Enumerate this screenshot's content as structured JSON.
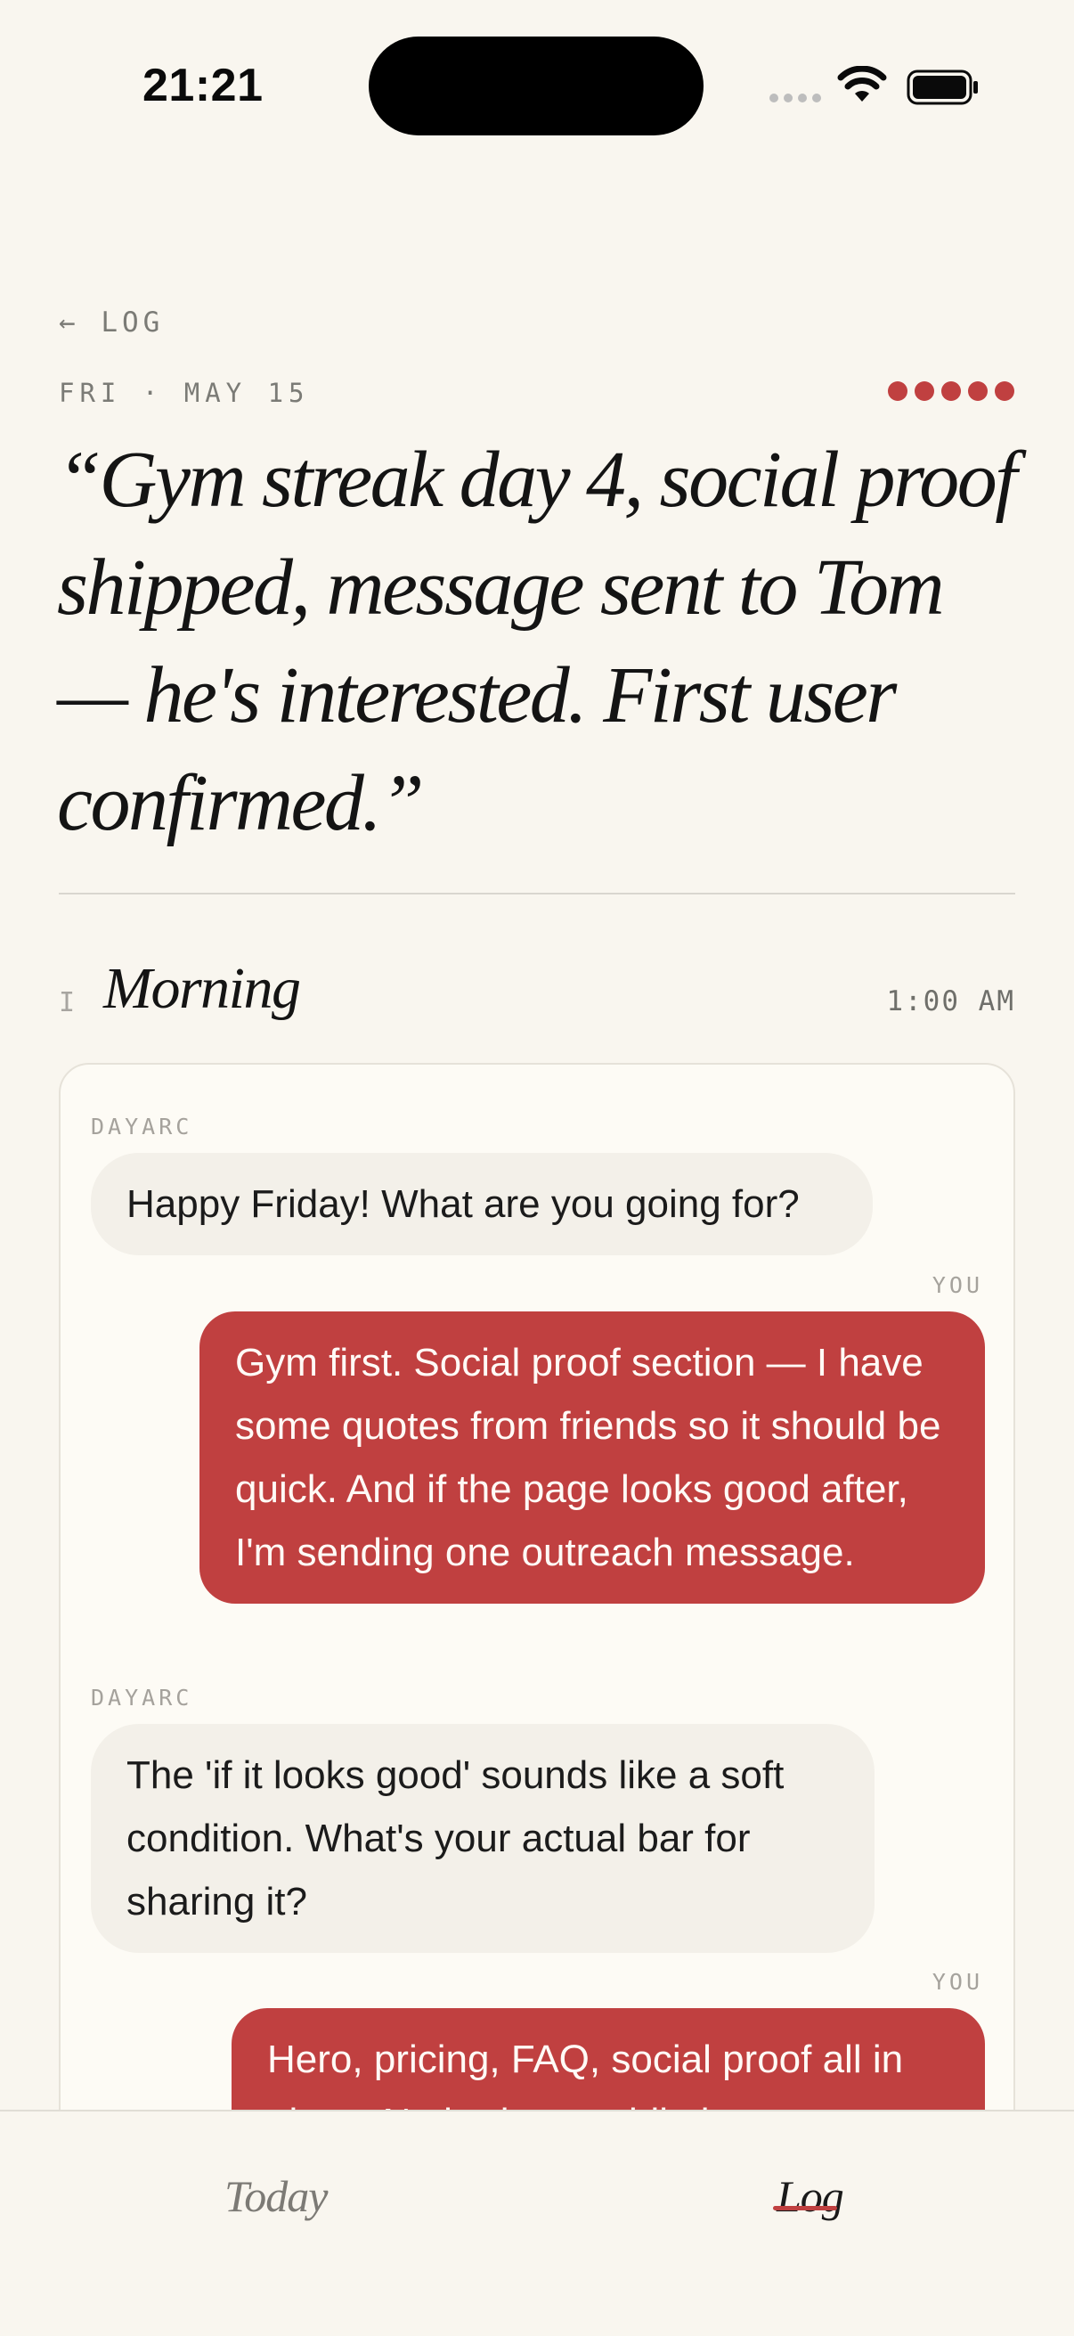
{
  "status_bar": {
    "time": "21:21"
  },
  "header": {
    "back_label": "← LOG",
    "date": "FRI · MAY 15",
    "rating": 5,
    "headline": "“Gym streak day 4, social proof shipped, message sent to Tom — he's interested. First user confirmed.”"
  },
  "section": {
    "number": "I",
    "title": "Morning",
    "time": "1:00 AM"
  },
  "chat": {
    "messages": [
      {
        "sender": "DAYARC",
        "text": "Happy Friday! What are you going for?"
      },
      {
        "sender": "YOU",
        "text": "Gym first. Social proof section — I have some quotes from friends so it should be quick. And if the page looks good after, I'm sending one outreach message."
      },
      {
        "sender": "DAYARC",
        "text": "The 'if it looks good' sounds like a soft condition. What's your actual bar for sharing it?"
      },
      {
        "sender": "YOU",
        "text": "Hero, pricing, FAQ, social proof all in place. No broken mobile layout."
      }
    ]
  },
  "bottom_nav": {
    "items": [
      {
        "label": "Today"
      },
      {
        "label": "Log"
      }
    ],
    "active": "Log"
  },
  "colors": {
    "accent": "#c04040",
    "background": "#f9f6ef",
    "card": "#fdfbf5"
  }
}
